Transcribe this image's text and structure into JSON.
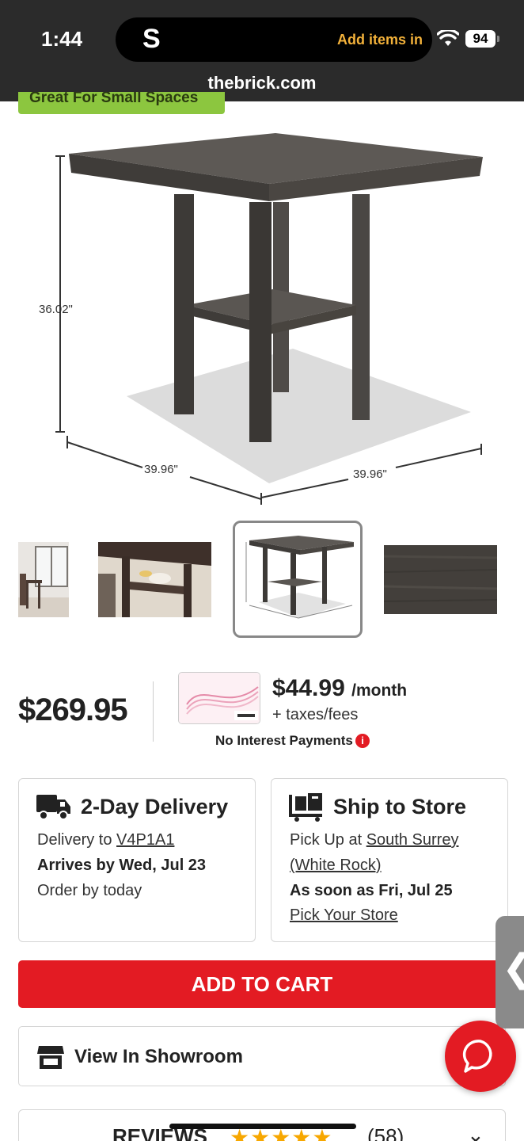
{
  "status_bar": {
    "time": "1:44",
    "island_letter": "S",
    "island_message": "Add items in",
    "battery": "94",
    "url": "thebrick.com"
  },
  "badge": {
    "label": "Great For Small Spaces"
  },
  "product_image": {
    "height_dim": "36.02\"",
    "width_dim_left": "39.96\"",
    "width_dim_right": "39.96\""
  },
  "thumbnails": [
    {
      "name": "dining-room-scene"
    },
    {
      "name": "table-closeup"
    },
    {
      "name": "table-dimensions",
      "selected": true
    },
    {
      "name": "wood-finish-swatch"
    }
  ],
  "pricing": {
    "price": "$269.95",
    "monthly": "$44.99",
    "monthly_unit": "/month",
    "taxes": "+ taxes/fees",
    "no_interest": "No Interest Payments",
    "info_glyph": "i"
  },
  "delivery": {
    "title": "2-Day Delivery",
    "delivery_to_prefix": "Delivery to",
    "postal_code": "V4P1A1",
    "arrives": "Arrives by Wed, Jul 23",
    "order_by": "Order by today"
  },
  "ship_to_store": {
    "title": "Ship to Store",
    "pickup_prefix": "Pick Up at",
    "store_line1": "South Surrey",
    "store_line2": "(White Rock)",
    "soonest": "As soon as Fri, Jul 25",
    "pick_store": "Pick Your Store"
  },
  "actions": {
    "add_to_cart": "ADD TO CART",
    "view_showroom": "View In Showroom"
  },
  "side_tab": {
    "glyph": "❮"
  },
  "reviews": {
    "label": "REVIEWS",
    "stars": "★★★★★",
    "count": "(58)",
    "chevron": "⌄"
  },
  "colors": {
    "brand_red": "#e31b23",
    "badge_green": "#8cc63f",
    "status_bar": "#2b2b2b",
    "wood": "#4a4744"
  }
}
